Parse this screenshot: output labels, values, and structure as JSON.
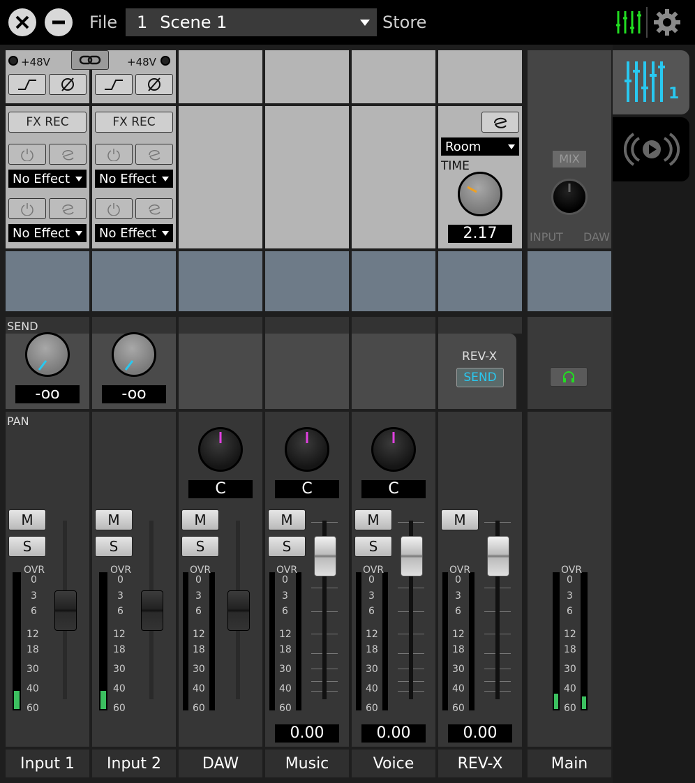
{
  "topbar": {
    "file_label": "File",
    "scene_number": "1",
    "scene_name": "Scene 1",
    "store_label": "Store"
  },
  "side_tabs": {
    "mixer_badge": "1"
  },
  "input_section": {
    "phantom_label_1": "+48V",
    "phantom_label_2": "+48V",
    "fx_rec_1": "FX REC",
    "fx_rec_2": "FX REC",
    "effect_1a": "No Effect",
    "effect_1b": "No Effect",
    "effect_2a": "No Effect",
    "effect_2b": "No Effect"
  },
  "reverb": {
    "type": "Room",
    "time_label": "TIME",
    "time_value": "2.17"
  },
  "monitor": {
    "mix_label": "MIX",
    "input_label": "INPUT",
    "daw_label": "DAW"
  },
  "send": {
    "section_label": "SEND",
    "input1_value": "-oo",
    "input2_value": "-oo",
    "revx_label": "REV-X",
    "revx_send": "SEND"
  },
  "pan": {
    "section_label": "PAN",
    "daw_value": "C",
    "music_value": "C",
    "voice_value": "C"
  },
  "buttons": {
    "mute": "M",
    "solo": "S"
  },
  "meter_scale": [
    "OVR",
    "0",
    "3",
    "6",
    "12",
    "18",
    "30",
    "40",
    "60"
  ],
  "faders": {
    "music_value": "0.00",
    "voice_value": "0.00",
    "revx_value": "0.00"
  },
  "channels": [
    "Input 1",
    "Input 2",
    "DAW",
    "Music",
    "Voice",
    "REV-X",
    "Main"
  ],
  "colors": {
    "accent_cyan": "#29c8f0",
    "pan_magenta": "#e040e0",
    "reverb_orange": "#f0a020",
    "meter_green": "#3cc060",
    "mixer_icon_green": "#22dd22"
  }
}
